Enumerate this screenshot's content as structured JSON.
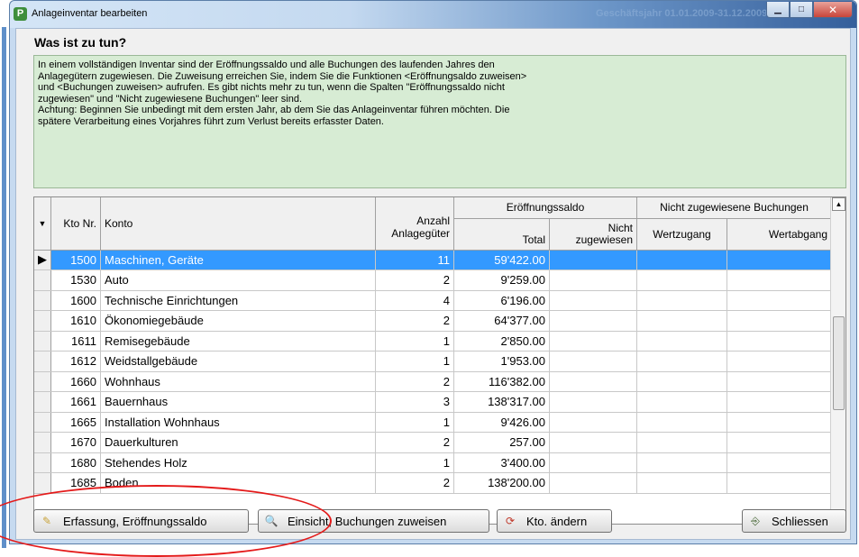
{
  "window": {
    "title": "Anlageinventar bearbeiten",
    "ghost_title": "Geschäftsjahr 01.01.2009-31.12.2009",
    "app_icon_letter": "P"
  },
  "heading": "Was ist zu tun?",
  "info_lines": [
    "In einem vollständigen Inventar sind der Eröffnungssaldo und alle Buchungen des laufenden Jahres den",
    "Anlagegütern zugewiesen. Die Zuweisung erreichen Sie, indem Sie die Funktionen <Eröffnungsaldo zuweisen>",
    "und <Buchungen zuweisen>  aufrufen. Es gibt nichts mehr zu tun, wenn die Spalten \"Eröffnungssaldo nicht",
    "zugewiesen\" und \"Nicht zugewiesene Buchungen\" leer sind.",
    "Achtung: Beginnen Sie unbedingt mit dem ersten Jahr, ab dem Sie das Anlageinventar führen möchten. Die",
    "spätere Verarbeitung eines Vorjahres führt zum Verlust bereits erfasster Daten."
  ],
  "table": {
    "headers": {
      "kto_nr": "Kto Nr.",
      "konto": "Konto",
      "anzahl_1": "Anzahl",
      "anzahl_2": "Anlagegüter",
      "eroeffnung": "Eröffnungssaldo",
      "total": "Total",
      "nicht_1": "Nicht",
      "nicht_2": "zugewiesen",
      "nicht_buchungen": "Nicht zugewiesene Buchungen",
      "wertzugang": "Wertzugang",
      "wertabgang": "Wertabgang"
    },
    "rows": [
      {
        "kto": "1500",
        "konto": "Maschinen, Geräte",
        "anzahl": "11",
        "total": "59'422.00",
        "selected": true
      },
      {
        "kto": "1530",
        "konto": "Auto",
        "anzahl": "2",
        "total": "9'259.00"
      },
      {
        "kto": "1600",
        "konto": "Technische Einrichtungen",
        "anzahl": "4",
        "total": "6'196.00"
      },
      {
        "kto": "1610",
        "konto": "Ökonomiegebäude",
        "anzahl": "2",
        "total": "64'377.00"
      },
      {
        "kto": "1611",
        "konto": "Remisegebäude",
        "anzahl": "1",
        "total": "2'850.00"
      },
      {
        "kto": "1612",
        "konto": "Weidstallgebäude",
        "anzahl": "1",
        "total": "1'953.00"
      },
      {
        "kto": "1660",
        "konto": "Wohnhaus",
        "anzahl": "2",
        "total": "116'382.00"
      },
      {
        "kto": "1661",
        "konto": "Bauernhaus",
        "anzahl": "3",
        "total": "138'317.00"
      },
      {
        "kto": "1665",
        "konto": "Installation Wohnhaus",
        "anzahl": "1",
        "total": "9'426.00"
      },
      {
        "kto": "1670",
        "konto": "Dauerkulturen",
        "anzahl": "2",
        "total": "257.00"
      },
      {
        "kto": "1680",
        "konto": "Stehendes Holz",
        "anzahl": "1",
        "total": "3'400.00"
      },
      {
        "kto": "1685",
        "konto": "Boden",
        "anzahl": "2",
        "total": "138'200.00"
      }
    ]
  },
  "buttons": {
    "erfassung": "Erfassung, Eröffnungssaldo",
    "einsicht": "Einsicht, Buchungen zuweisen",
    "kto_aendern": "Kto. ändern",
    "schliessen": "Schliessen"
  },
  "icons": {
    "erfassung": "pencil-icon",
    "einsicht": "magnifier-icon",
    "kto_aendern": "refresh-icon",
    "schliessen": "exit-door-icon"
  },
  "colors": {
    "selection": "#3399ff",
    "info_bg": "#d7ecd4",
    "annotation_oval": "#e41a1a"
  }
}
